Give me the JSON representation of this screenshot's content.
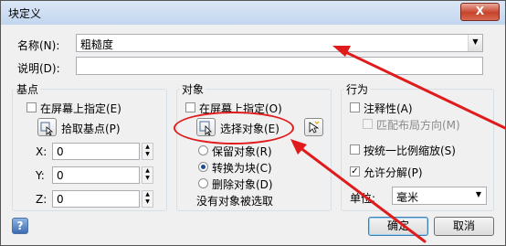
{
  "window": {
    "title": "块定义",
    "close_label": "X"
  },
  "name_field": {
    "label": "名称(N):",
    "value": "粗糙度"
  },
  "description_field": {
    "label": "说明(D):",
    "value": ""
  },
  "base_point": {
    "title": "基点",
    "specify_on_screen": "在屏幕上指定(E)",
    "pick_label": "拾取基点(P)",
    "x_label": "X:",
    "x_value": "0",
    "y_label": "Y:",
    "y_value": "0",
    "z_label": "Z:",
    "z_value": "0"
  },
  "objects": {
    "title": "对象",
    "specify_on_screen": "在屏幕上指定(O)",
    "select_label": "选择对象(E)",
    "options": [
      "保留对象(R)",
      "转换为块(C)",
      "删除对象(D)"
    ],
    "selected_option": "转换为块(C)",
    "status": "没有对象被选取"
  },
  "behavior": {
    "title": "行为",
    "annotative": "注释性(A)",
    "match_layout": "匹配布局方向(M)",
    "scale_uniformly": "按统一比例缩放(S)",
    "allow_explode": "允许分解(P)",
    "allow_explode_checked": true,
    "unit_label": "单位:",
    "unit_value": "毫米"
  },
  "buttons": {
    "ok": "确定",
    "cancel": "取消",
    "help": "?"
  },
  "colors": {
    "annotation_red": "#e01b1b"
  }
}
